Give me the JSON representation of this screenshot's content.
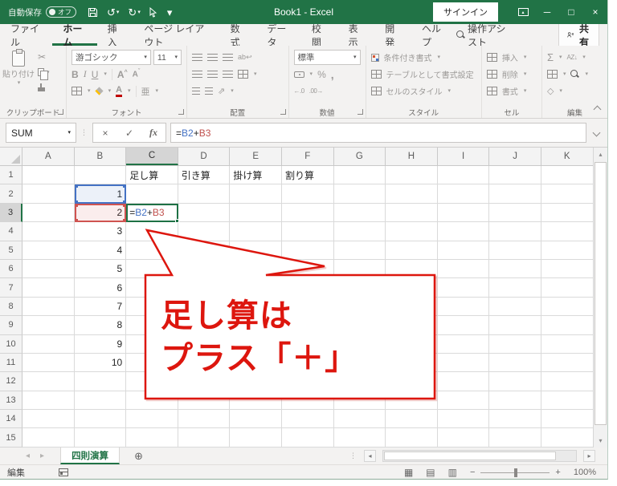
{
  "titlebar": {
    "autosave_label": "自動保存",
    "autosave_state": "オフ",
    "title": "Book1 - Excel",
    "signin_label": "サインイン"
  },
  "tabs": {
    "file": "ファイル",
    "items": [
      "ホーム",
      "挿入",
      "ページ レイアウト",
      "数式",
      "データ",
      "校閲",
      "表示",
      "開発",
      "ヘルプ"
    ],
    "active": "ホーム",
    "assist": "操作アシスト",
    "share": "共有"
  },
  "ribbon": {
    "clipboard": {
      "label": "クリップボード",
      "paste": "貼り付け"
    },
    "font": {
      "label": "フォント",
      "name": "游ゴシック",
      "size": "11",
      "bold": "B",
      "italic": "I",
      "underline": "U",
      "grow": "A",
      "shrink": "A",
      "phonetic": "亜"
    },
    "align": {
      "label": "配置"
    },
    "number": {
      "label": "数値",
      "format": "標準",
      "percent": "%",
      "comma": ",",
      "inc_decimal": "←.0",
      "dec_decimal": ".00→"
    },
    "styles": {
      "label": "スタイル",
      "conditional": "条件付き書式",
      "table": "テーブルとして書式設定",
      "cellstyles": "セルのスタイル"
    },
    "cells": {
      "label": "セル",
      "insert": "挿入",
      "delete": "削除",
      "format": "書式"
    },
    "edit": {
      "label": "編集",
      "sum": "Σ",
      "sort": "AZ↓",
      "fill": "↓",
      "clear": "◇"
    }
  },
  "formula_bar": {
    "name_box": "SUM",
    "fx": "fx"
  },
  "formula": {
    "eq": "=",
    "ref1": "B2",
    "op": "+",
    "ref2": "B3"
  },
  "grid": {
    "columns": [
      "A",
      "B",
      "C",
      "D",
      "E",
      "F",
      "G",
      "H",
      "I",
      "J",
      "K"
    ],
    "row_count": 15,
    "selected_column": "C",
    "selected_row": "3",
    "active_cell": "C3",
    "cells": {
      "C1": "足し算",
      "D1": "引き算",
      "E1": "掛け算",
      "F1": "割り算",
      "B2": "1",
      "B3": "2",
      "B4": "3",
      "B5": "4",
      "B6": "5",
      "B7": "6",
      "B8": "7",
      "B9": "8",
      "B10": "9",
      "B11": "10"
    }
  },
  "callout": {
    "line1": "足し算は",
    "line2": "プラス「＋」",
    "color": "#dd160e"
  },
  "sheet_bar": {
    "active_tab": "四則演算"
  },
  "status_bar": {
    "mode": "編集",
    "zoom_level": "100%"
  },
  "icons": {
    "undo": "↺",
    "redo": "↻",
    "dropdown": "▾",
    "minimize": "─",
    "maximize": "□",
    "close": "×",
    "cut": "✂",
    "cancel": "×",
    "enter": "✓",
    "up": "▴",
    "down": "▾",
    "left": "◂",
    "right": "▸",
    "dots": "⋮",
    "add_sheet": "⊕",
    "wrap": "↩",
    "orientation": "⇗",
    "currency_dot": "¥",
    "normal_view": "▦",
    "page_layout_view": "▤",
    "page_break_view": "▥",
    "zoom_out": "−",
    "zoom_in": "+"
  },
  "colors": {
    "accent_green": "#217346",
    "ref1_blue": "#4472c4",
    "ref2_red": "#cf5350",
    "callout_red": "#dd160e"
  }
}
